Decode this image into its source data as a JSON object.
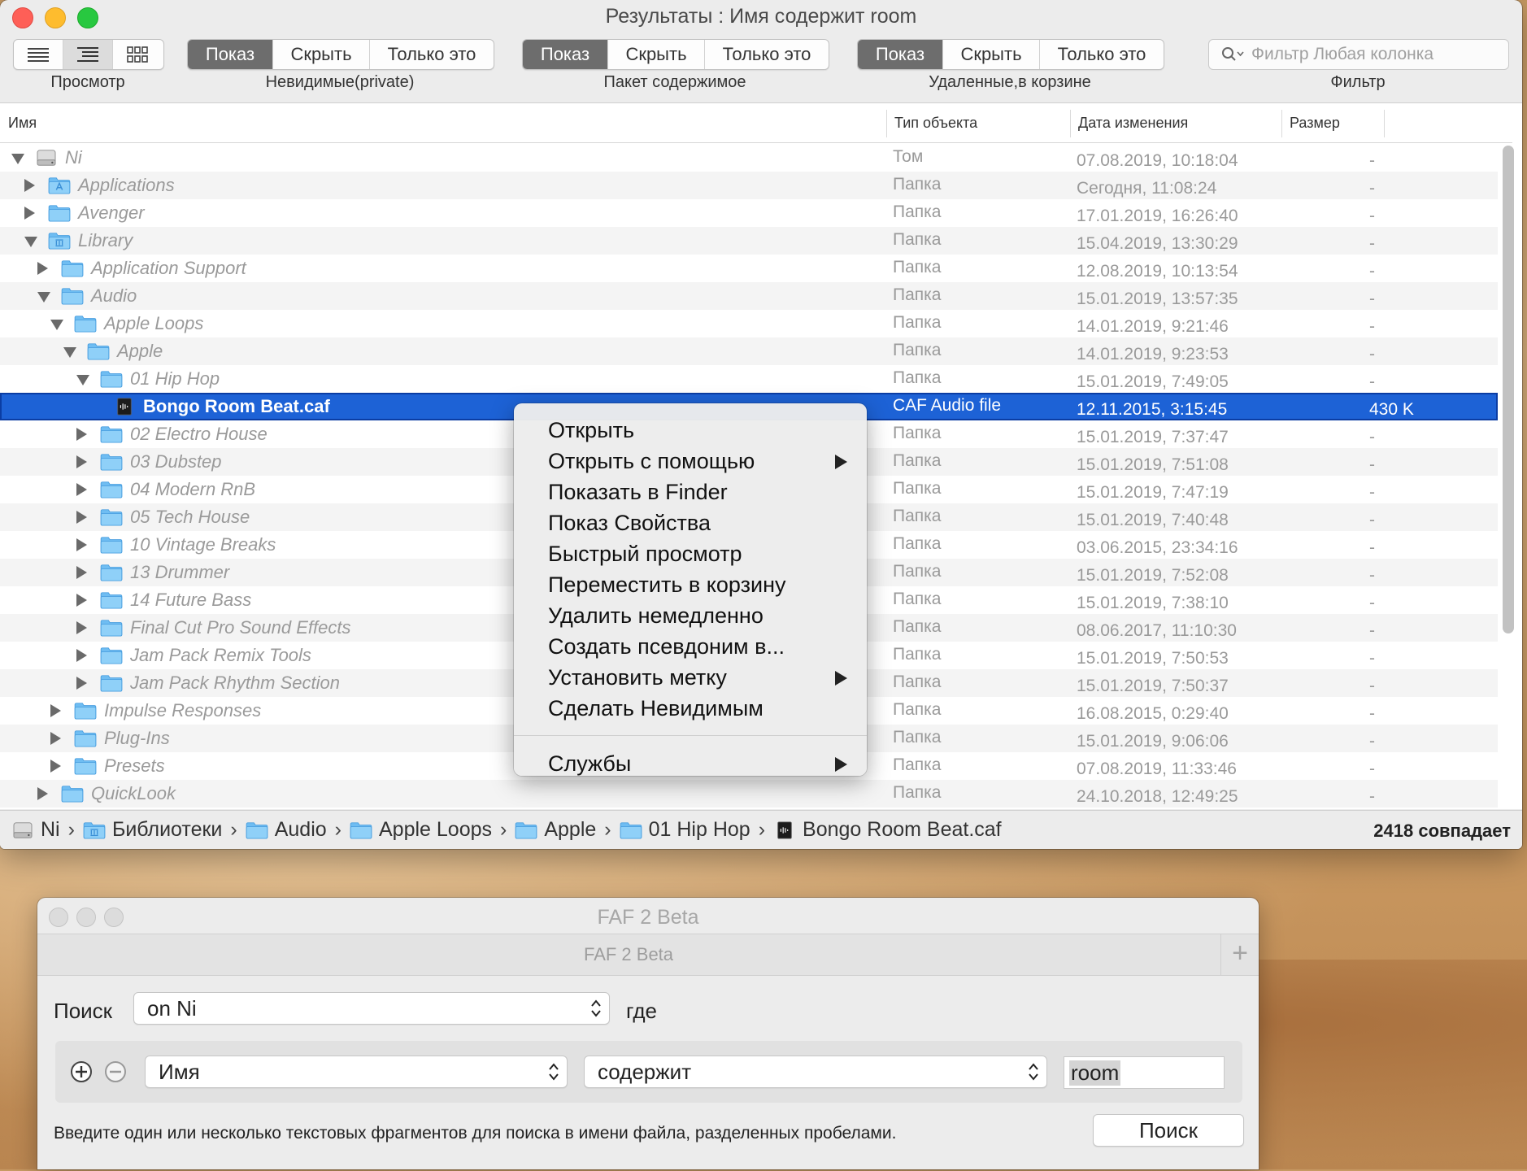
{
  "main_window": {
    "title": "Результаты : Имя содержит room",
    "toolbar": {
      "view_label": "Просмотр",
      "groups": [
        {
          "label": "Невидимые(private)",
          "buttons": [
            "Показ",
            "Скрыть",
            "Только это"
          ],
          "selected": 0
        },
        {
          "label": "Пакет содержимое",
          "buttons": [
            "Показ",
            "Скрыть",
            "Только это"
          ],
          "selected": 0
        },
        {
          "label": "Удаленные,в корзине",
          "buttons": [
            "Показ",
            "Скрыть",
            "Только это"
          ],
          "selected": 0
        }
      ],
      "filter_placeholder": "Фильтр Любая колонка",
      "filter_label": "Фильтр"
    },
    "columns": {
      "name": "Имя",
      "kind": "Тип объекта",
      "date": "Дата изменения",
      "size": "Размер"
    },
    "rows": [
      {
        "name": "Ni",
        "kind": "Том",
        "date": "07.08.2019, 10:18:04",
        "size": "-",
        "depth": 0,
        "disclosure": "down",
        "icon": "drive-icon"
      },
      {
        "name": "Applications",
        "kind": "Папка",
        "date": "Сегодня, 11:08:24",
        "size": "-",
        "depth": 1,
        "disclosure": "right",
        "icon": "applications-folder-icon"
      },
      {
        "name": "Avenger",
        "kind": "Папка",
        "date": "17.01.2019, 16:26:40",
        "size": "-",
        "depth": 1,
        "disclosure": "right",
        "icon": "folder-icon"
      },
      {
        "name": "Library",
        "kind": "Папка",
        "date": "15.04.2019, 13:30:29",
        "size": "-",
        "depth": 1,
        "disclosure": "down",
        "icon": "library-folder-icon"
      },
      {
        "name": "Application Support",
        "kind": "Папка",
        "date": "12.08.2019, 10:13:54",
        "size": "-",
        "depth": 2,
        "disclosure": "right",
        "icon": "folder-icon"
      },
      {
        "name": "Audio",
        "kind": "Папка",
        "date": "15.01.2019, 13:57:35",
        "size": "-",
        "depth": 2,
        "disclosure": "down",
        "icon": "folder-icon"
      },
      {
        "name": "Apple Loops",
        "kind": "Папка",
        "date": "14.01.2019, 9:21:46",
        "size": "-",
        "depth": 3,
        "disclosure": "down",
        "icon": "folder-icon"
      },
      {
        "name": "Apple",
        "kind": "Папка",
        "date": "14.01.2019, 9:23:53",
        "size": "-",
        "depth": 4,
        "disclosure": "down",
        "icon": "folder-icon"
      },
      {
        "name": "01 Hip Hop",
        "kind": "Папка",
        "date": "15.01.2019, 7:49:05",
        "size": "-",
        "depth": 5,
        "disclosure": "down",
        "icon": "folder-icon"
      },
      {
        "name": "Bongo Room Beat.caf",
        "kind": "CAF Audio file",
        "date": "12.11.2015, 3:15:45",
        "size": "430 K",
        "depth": 6,
        "disclosure": "none",
        "icon": "audio-file-icon",
        "selected": true
      },
      {
        "name": "02 Electro House",
        "kind": "Папка",
        "date": "15.01.2019, 7:37:47",
        "size": "-",
        "depth": 5,
        "disclosure": "right",
        "icon": "folder-icon"
      },
      {
        "name": "03 Dubstep",
        "kind": "Папка",
        "date": "15.01.2019, 7:51:08",
        "size": "-",
        "depth": 5,
        "disclosure": "right",
        "icon": "folder-icon"
      },
      {
        "name": "04 Modern RnB",
        "kind": "Папка",
        "date": "15.01.2019, 7:47:19",
        "size": "-",
        "depth": 5,
        "disclosure": "right",
        "icon": "folder-icon"
      },
      {
        "name": "05 Tech House",
        "kind": "Папка",
        "date": "15.01.2019, 7:40:48",
        "size": "-",
        "depth": 5,
        "disclosure": "right",
        "icon": "folder-icon"
      },
      {
        "name": "10 Vintage Breaks",
        "kind": "Папка",
        "date": "03.06.2015, 23:34:16",
        "size": "-",
        "depth": 5,
        "disclosure": "right",
        "icon": "folder-icon"
      },
      {
        "name": "13 Drummer",
        "kind": "Папка",
        "date": "15.01.2019, 7:52:08",
        "size": "-",
        "depth": 5,
        "disclosure": "right",
        "icon": "folder-icon"
      },
      {
        "name": "14 Future Bass",
        "kind": "Папка",
        "date": "15.01.2019, 7:38:10",
        "size": "-",
        "depth": 5,
        "disclosure": "right",
        "icon": "folder-icon"
      },
      {
        "name": "Final Cut Pro Sound Effects",
        "kind": "Папка",
        "date": "08.06.2017, 11:10:30",
        "size": "-",
        "depth": 5,
        "disclosure": "right",
        "icon": "folder-icon"
      },
      {
        "name": "Jam Pack Remix Tools",
        "kind": "Папка",
        "date": "15.01.2019, 7:50:53",
        "size": "-",
        "depth": 5,
        "disclosure": "right",
        "icon": "folder-icon"
      },
      {
        "name": "Jam Pack Rhythm Section",
        "kind": "Папка",
        "date": "15.01.2019, 7:50:37",
        "size": "-",
        "depth": 5,
        "disclosure": "right",
        "icon": "folder-icon"
      },
      {
        "name": "Impulse Responses",
        "kind": "Папка",
        "date": "16.08.2015, 0:29:40",
        "size": "-",
        "depth": 3,
        "disclosure": "right",
        "icon": "folder-icon"
      },
      {
        "name": "Plug-Ins",
        "kind": "Папка",
        "date": "15.01.2019, 9:06:06",
        "size": "-",
        "depth": 3,
        "disclosure": "right",
        "icon": "folder-icon"
      },
      {
        "name": "Presets",
        "kind": "Папка",
        "date": "07.08.2019, 11:33:46",
        "size": "-",
        "depth": 3,
        "disclosure": "right",
        "icon": "folder-icon"
      },
      {
        "name": "QuickLook",
        "kind": "Папка",
        "date": "24.10.2018, 12:49:25",
        "size": "-",
        "depth": 2,
        "disclosure": "right",
        "icon": "folder-icon"
      }
    ],
    "context_menu": {
      "items": [
        {
          "label": "Открыть",
          "submenu": false
        },
        {
          "label": "Открыть с помощью",
          "submenu": true
        },
        {
          "label": "Показать в Finder",
          "submenu": false
        },
        {
          "label": "Показ Свойства",
          "submenu": false
        },
        {
          "label": "Быстрый просмотр",
          "submenu": false
        },
        {
          "label": "Переместить в корзину",
          "submenu": false
        },
        {
          "label": "Удалить немедленно",
          "submenu": false
        },
        {
          "label": "Создать псевдоним в...",
          "submenu": false
        },
        {
          "label": "Установить метку",
          "submenu": true
        },
        {
          "label": "Сделать Невидимым",
          "submenu": false
        }
      ],
      "services": {
        "label": "Службы",
        "submenu": true
      }
    },
    "path": [
      {
        "label": "Ni",
        "icon": "drive-icon"
      },
      {
        "label": "Библиотеки",
        "icon": "library-folder-icon"
      },
      {
        "label": "Audio",
        "icon": "folder-icon"
      },
      {
        "label": "Apple Loops",
        "icon": "folder-icon"
      },
      {
        "label": "Apple",
        "icon": "folder-icon"
      },
      {
        "label": "01 Hip Hop",
        "icon": "folder-icon"
      },
      {
        "label": "Bongo Room Beat.caf",
        "icon": "audio-file-icon"
      }
    ],
    "path_separator": "›",
    "match_count": "2418 совпадает"
  },
  "faf_window": {
    "title": "FAF 2 Beta",
    "tab_label": "FAF 2 Beta",
    "add_tab": "+",
    "search_label": "Поиск",
    "location_value": "on Ni",
    "where_label": "где",
    "criteria": {
      "field": "Имя",
      "operator": "содержит",
      "value": "room"
    },
    "hint": "Введите один или несколько текстовых фрагментов для поиска в имени файла, разделенных пробелами.",
    "search_button": "Поиск"
  },
  "colors": {
    "selection": "#1d62d6",
    "folder": "#6fbdf2",
    "segment_selected": "#6d6d6d",
    "close": "#fe5f57",
    "minimize": "#febc2e",
    "zoom": "#28c840"
  }
}
